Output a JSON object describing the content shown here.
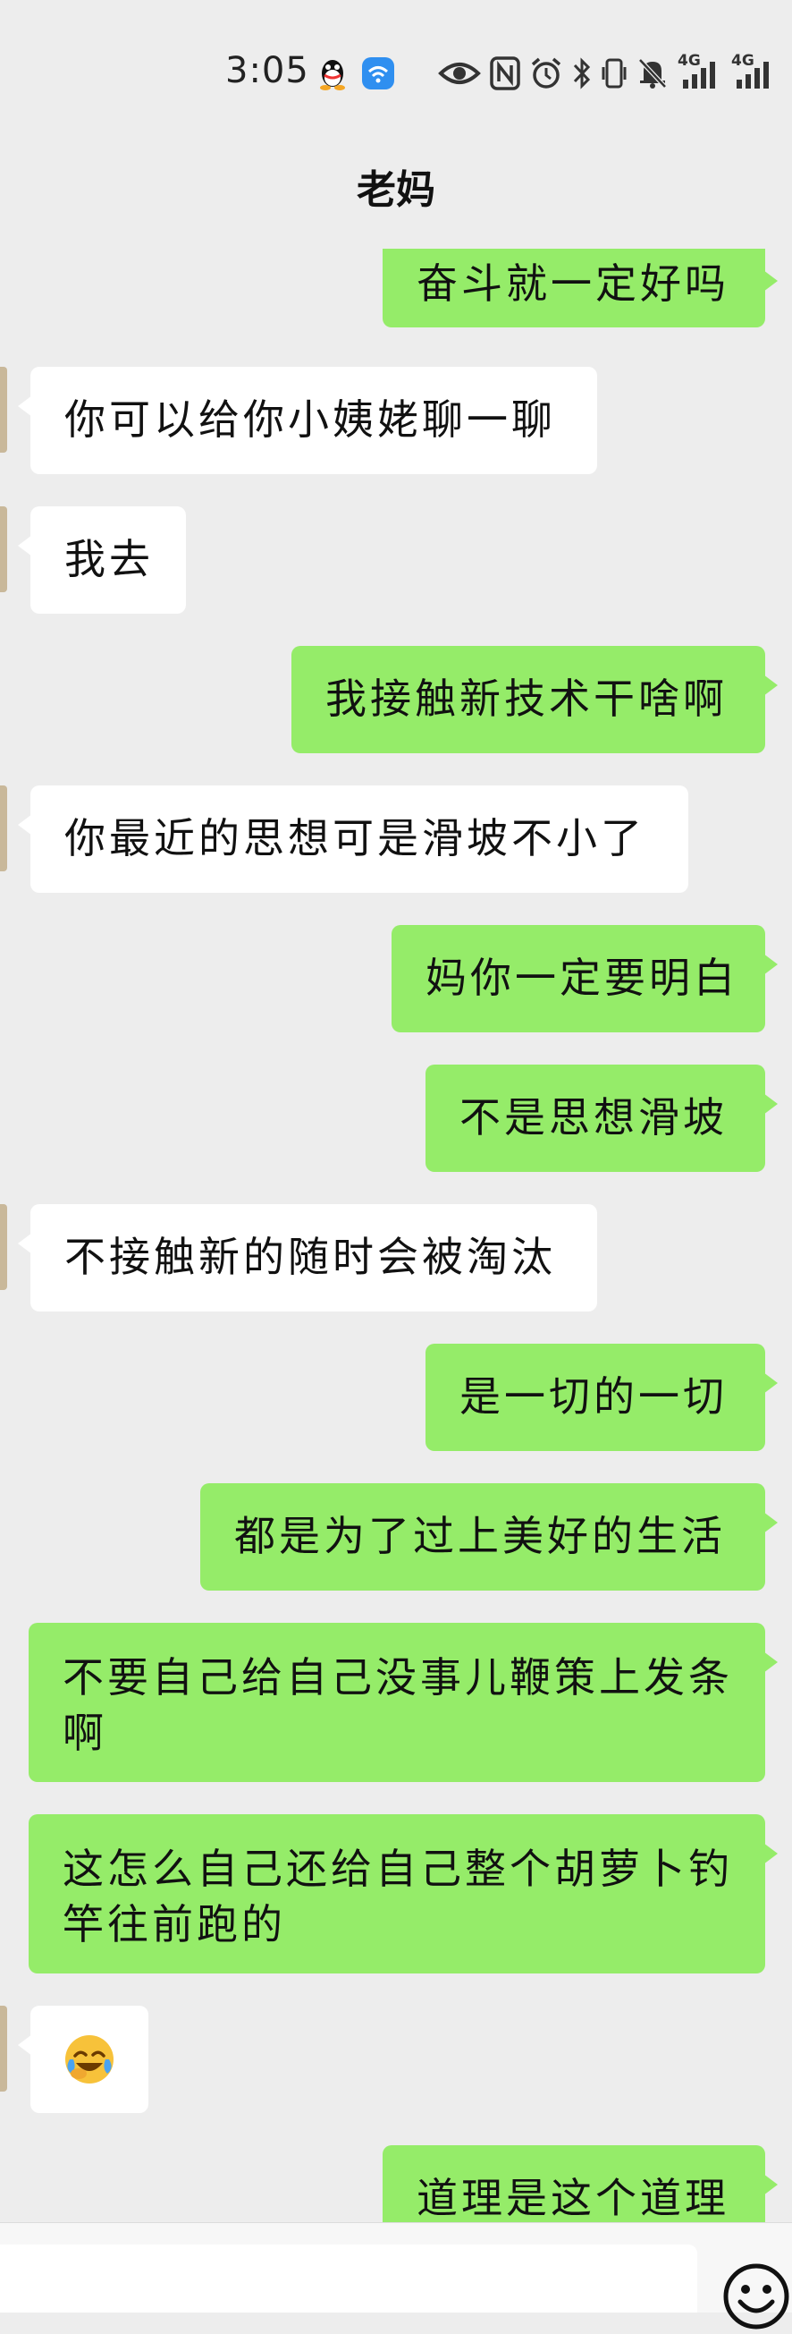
{
  "status_bar": {
    "time": "3:05",
    "network_1": "4G",
    "network_2": "4G",
    "icons": [
      "qq-icon",
      "wifi-app-icon",
      "eye-icon",
      "nfc-icon",
      "alarm-icon",
      "bluetooth-icon",
      "vibrate-icon",
      "mute-icon",
      "signal-icon"
    ]
  },
  "header": {
    "title": "老妈"
  },
  "messages": [
    {
      "side": "out",
      "text": "奋斗就一定好吗"
    },
    {
      "side": "in",
      "text": "你可以给你小姨姥聊一聊"
    },
    {
      "side": "in",
      "text": "我去"
    },
    {
      "side": "out",
      "text": "我接触新技术干啥啊"
    },
    {
      "side": "in",
      "text": "你最近的思想可是滑坡不小了"
    },
    {
      "side": "out",
      "text": "妈你一定要明白"
    },
    {
      "side": "out",
      "text": "不是思想滑坡"
    },
    {
      "side": "in",
      "text": "不接触新的随时会被淘汰"
    },
    {
      "side": "out",
      "text": "是一切的一切"
    },
    {
      "side": "out",
      "text": "都是为了过上美好的生活"
    },
    {
      "side": "out",
      "text": "不要自己给自己没事儿鞭策上发条啊"
    },
    {
      "side": "out",
      "text": "这怎么自己还给自己整个胡萝卜钓竿往前跑的"
    },
    {
      "side": "in",
      "text": "",
      "emoji": "crying-laughing-emoji"
    },
    {
      "side": "out",
      "text": "道理是这个道理"
    }
  ],
  "colors": {
    "background": "#ededed",
    "outgoing_bubble": "#95ec69",
    "incoming_bubble": "#ffffff"
  }
}
